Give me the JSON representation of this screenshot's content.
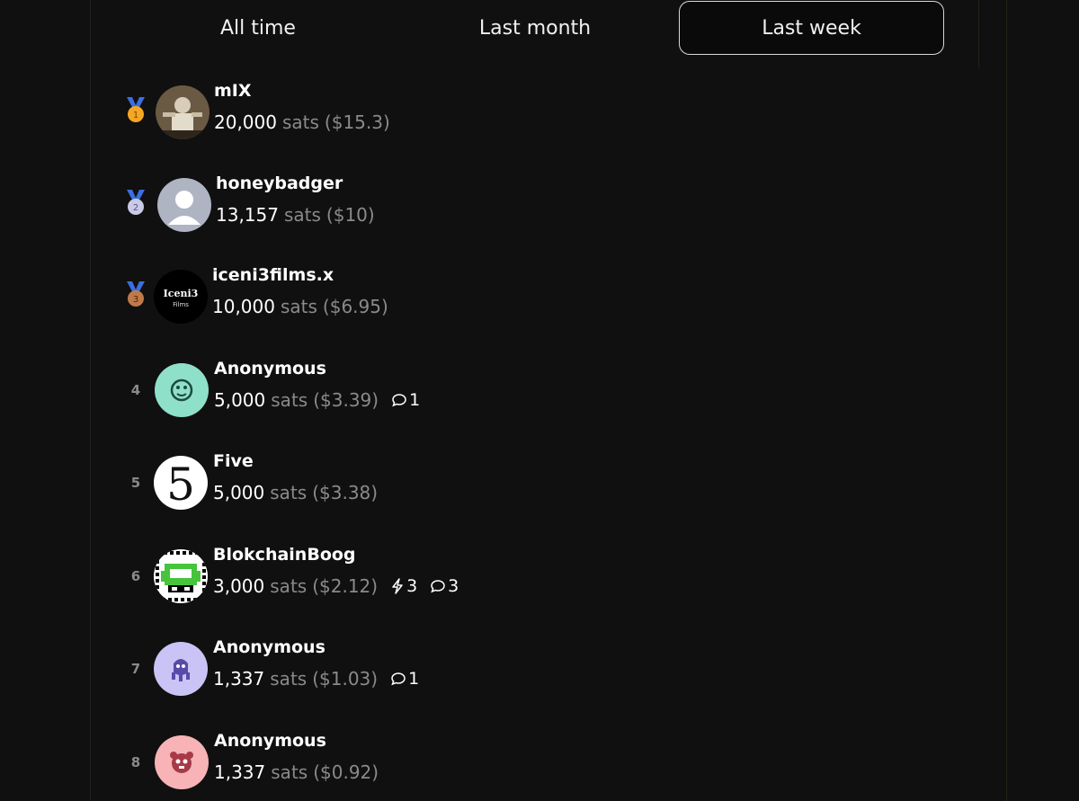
{
  "tabs": [
    {
      "label": "All time",
      "active": false
    },
    {
      "label": "Last month",
      "active": false
    },
    {
      "label": "Last week",
      "active": true
    }
  ],
  "leaderboard": [
    {
      "rank": "1",
      "name": "mIX",
      "amount": "20,000",
      "unit": "sats",
      "usd": "($15.3)",
      "avatar": "photo-avatar",
      "medal": "gold"
    },
    {
      "rank": "2",
      "name": "honeybadger",
      "amount": "13,157",
      "unit": "sats",
      "usd": "($10)",
      "avatar": "default-person-avatar",
      "medal": "silver"
    },
    {
      "rank": "3",
      "name": "iceni3films.x",
      "amount": "10,000",
      "unit": "sats",
      "usd": "($6.95)",
      "avatar": "iceni3-films-logo",
      "avatar_text": "Iceni3",
      "avatar_subtext": "Films",
      "medal": "bronze"
    },
    {
      "rank": "4",
      "name": "Anonymous",
      "amount": "5,000",
      "unit": "sats",
      "usd": "($3.39)",
      "comments": "1",
      "avatar": "anon-mint-avatar"
    },
    {
      "rank": "5",
      "name": "Five",
      "amount": "5,000",
      "unit": "sats",
      "usd": "($3.38)",
      "avatar": "five-avatar",
      "avatar_text": "5"
    },
    {
      "rank": "6",
      "name": "BlokchainBoog",
      "amount": "3,000",
      "unit": "sats",
      "usd": "($2.12)",
      "zaps": "3",
      "comments": "3",
      "avatar": "pixel-creature-avatar"
    },
    {
      "rank": "7",
      "name": "Anonymous",
      "amount": "1,337",
      "unit": "sats",
      "usd": "($1.03)",
      "comments": "1",
      "avatar": "anon-lavender-avatar"
    },
    {
      "rank": "8",
      "name": "Anonymous",
      "amount": "1,337",
      "unit": "sats",
      "usd": "($0.92)",
      "avatar": "anon-pink-avatar"
    }
  ],
  "colors": {
    "background": "#101010",
    "muted": "#8a8a8a",
    "gold": "#f5a623",
    "silver": "#c9c9e8",
    "bronze": "#c07a4a",
    "ribbon": "#3b6ee0"
  }
}
